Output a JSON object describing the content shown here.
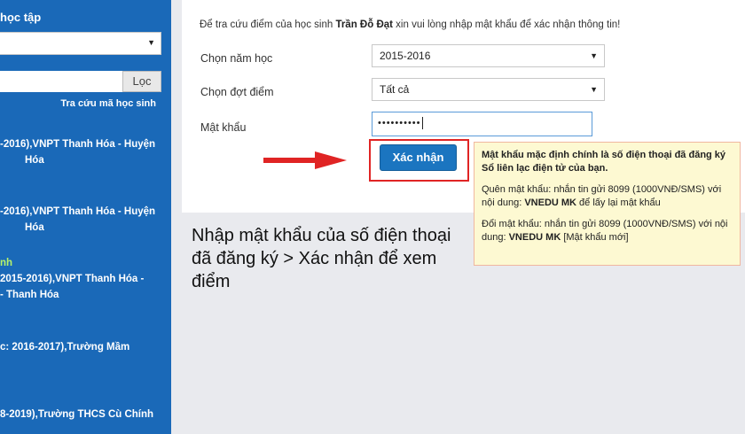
{
  "sidebar": {
    "title": "học tập",
    "search_button": "Lọc",
    "lookup_link": "Tra cứu mã học sinh",
    "items": [
      {
        "line1": "-2016),VNPT Thanh Hóa - Huyện",
        "line2": "Hóa"
      },
      {
        "line1": "-2016),VNPT Thanh Hóa - Huyện",
        "line2": "Hóa"
      },
      {
        "line0": "nh",
        "line1": "2015-2016),VNPT Thanh Hóa -",
        "line2": "- Thanh Hóa"
      },
      {
        "line1": "c: 2016-2017),Trường Mầm"
      },
      {
        "line1": "8-2019),Trường THCS Cù Chính"
      }
    ]
  },
  "form": {
    "intro_prefix": "Để tra cứu điểm của học sinh ",
    "student_name": "Trần Đỗ Đạt",
    "intro_suffix": " xin vui lòng nhập mật khẩu để xác nhận thông tin!",
    "year_label": "Chọn năm học",
    "year_value": "2015-2016",
    "term_label": "Chọn đợt điểm",
    "term_value": "Tất cả",
    "password_label": "Mật khẩu",
    "password_value": "••••••••••",
    "submit_label": "Xác nhận"
  },
  "tip": {
    "line1": "Mật khẩu mặc định chính là số điện thoại đã đăng ký Sổ liên lạc điện tử của bạn.",
    "forgot_prefix": "Quên mật khẩu: nhắn tin gửi 8099 (1000VNĐ/SMS) với nội dung: ",
    "forgot_code": "VNEDU MK",
    "forgot_suffix": " để lấy lại mật khẩu",
    "change_prefix": "Đổi mật khẩu: nhắn tin gửi 8099 (1000VNĐ/SMS) với nội dung: ",
    "change_code": "VNEDU MK",
    "change_suffix": " [Mật khẩu mới]"
  },
  "caption": "Nhập mật khẩu của số điện thoại đã đăng ký > Xác nhận để xem điểm",
  "colors": {
    "sidebar": "#1a69b8",
    "button": "#1b75c0",
    "highlight": "#e02424",
    "tip_bg": "#fdf9d2"
  }
}
